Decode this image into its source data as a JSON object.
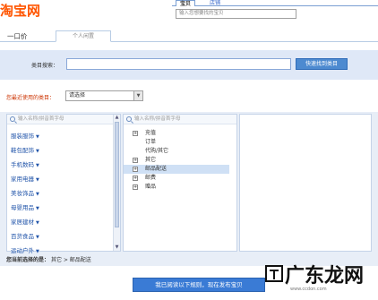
{
  "logo": {
    "text": "淘宝网"
  },
  "top_search": {
    "tabs": [
      "宝贝",
      "店铺"
    ],
    "placeholder": "输入您想要找的宝贝"
  },
  "nav": {
    "tab1": "一口价",
    "tab2": "个人闲置"
  },
  "category_search": {
    "label": "类目搜索：",
    "value": "",
    "button": "快速找到类目"
  },
  "recent": {
    "label": "您最近使用的类目：",
    "select_value": "请选择"
  },
  "panel1": {
    "search_placeholder": "输入名称/拼音首字母",
    "items": [
      {
        "label": "服装服饰"
      },
      {
        "label": "鞋包配饰"
      },
      {
        "label": "手机数码"
      },
      {
        "label": "家用电器"
      },
      {
        "label": "美妆饰品"
      },
      {
        "label": "母婴用品"
      },
      {
        "label": "家居建材"
      },
      {
        "label": "百货食品"
      },
      {
        "label": "运动户外"
      }
    ]
  },
  "panel2": {
    "search_placeholder": "输入名称/拼音首字母",
    "items": [
      {
        "label": "充值",
        "expandable": true,
        "selected": false
      },
      {
        "label": "订单",
        "expandable": false,
        "selected": false
      },
      {
        "label": "代购/其它",
        "expandable": false,
        "selected": false
      },
      {
        "label": "其它",
        "expandable": true,
        "selected": false
      },
      {
        "label": "邮品配送",
        "expandable": true,
        "selected": true
      },
      {
        "label": "邮费",
        "expandable": true,
        "selected": false
      },
      {
        "label": "赠品",
        "expandable": true,
        "selected": false
      }
    ]
  },
  "selected": {
    "label": "您当前选择的是：",
    "path": "其它 > 邮品配送"
  },
  "submit": {
    "label": "我已阅读以下规则，现在发布宝贝"
  },
  "watermark": {
    "text": "广东龙网",
    "sub": "www.ccdon.com"
  },
  "colors": {
    "brand": "#ff5500",
    "accent": "#3a7bd5",
    "band": "#dfe8f7"
  }
}
